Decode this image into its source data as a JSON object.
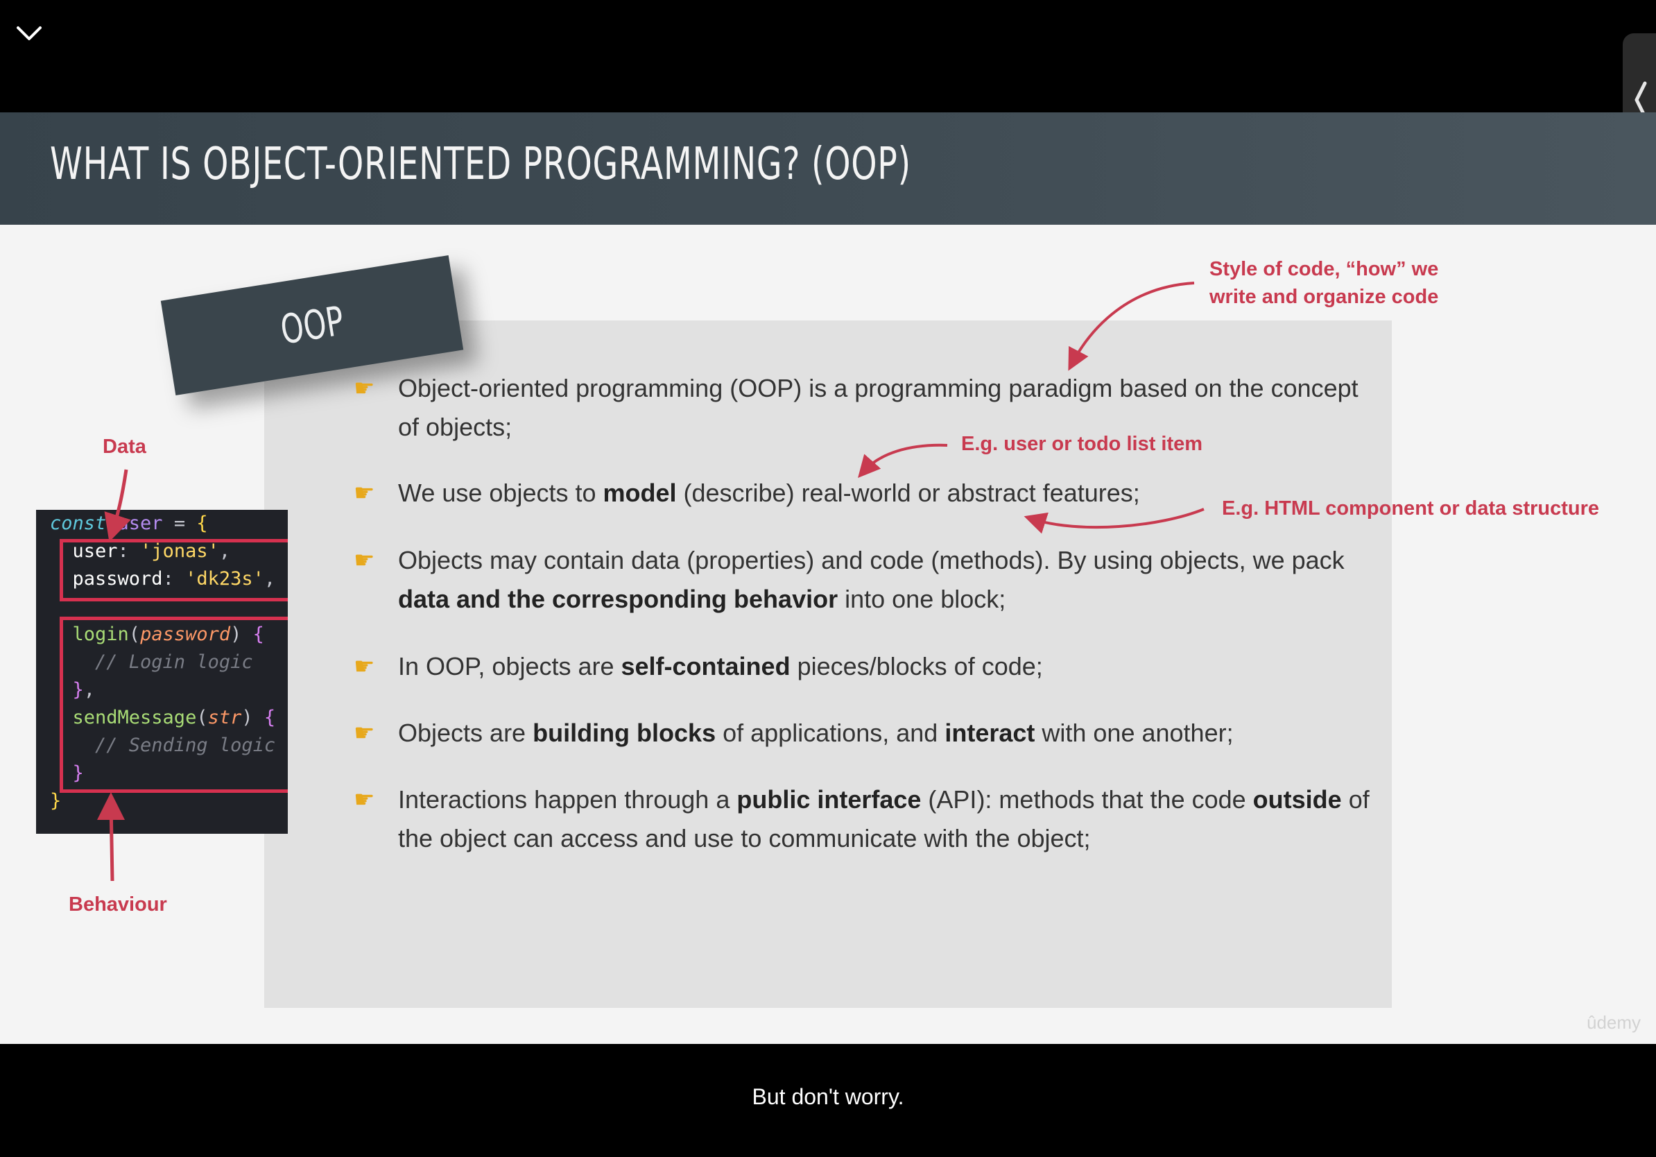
{
  "player": {
    "collapse_icon": "chevron-down-icon",
    "sidebar_toggle_icon": "chevron-left-icon",
    "caption": "But don't worry."
  },
  "slide": {
    "title": "WHAT IS OBJECT-ORIENTED PROGRAMMING? (OOP)",
    "tag": "OOP",
    "watermark": "ûdemy",
    "bullets": [
      {
        "parts": [
          {
            "t": "Object-oriented programming (OOP) is a programming paradigm based on the concept of objects;"
          }
        ]
      },
      {
        "parts": [
          {
            "t": "We use objects to "
          },
          {
            "t": "model",
            "b": true
          },
          {
            "t": " (describe) real-world or abstract features;"
          }
        ]
      },
      {
        "parts": [
          {
            "t": "Objects may contain data (properties) and code (methods). By using objects, we pack "
          },
          {
            "t": "data and the corresponding behavior",
            "b": true
          },
          {
            "t": " into one block;"
          }
        ]
      },
      {
        "parts": [
          {
            "t": "In OOP, objects are "
          },
          {
            "t": "self-contained",
            "b": true
          },
          {
            "t": " pieces/blocks of code;"
          }
        ]
      },
      {
        "parts": [
          {
            "t": "Objects are "
          },
          {
            "t": "building blocks",
            "b": true
          },
          {
            "t": " of applications, and "
          },
          {
            "t": "interact",
            "b": true
          },
          {
            "t": " with one another;"
          }
        ]
      },
      {
        "parts": [
          {
            "t": "Interactions happen through a "
          },
          {
            "t": "public interface",
            "b": true
          },
          {
            "t": " (API): methods that the code "
          },
          {
            "t": "outside",
            "b": true
          },
          {
            "t": " of the object can access and use to communicate with the object;"
          }
        ]
      }
    ],
    "annotations": {
      "style": "Style of code, “how” we write and organize code",
      "user": "E.g. user or todo list item",
      "html": "E.g. HTML component or data structure",
      "data": "Data",
      "behaviour": "Behaviour"
    },
    "code_lines": [
      [
        {
          "t": "const",
          "c": "#5fc9dc",
          "i": true
        },
        {
          "t": " user ",
          "c": "#b58cf0"
        },
        {
          "t": "=",
          "c": "#c6c8d0"
        },
        {
          "t": " {",
          "c": "#ffd84a"
        }
      ],
      [
        {
          "t": "  user",
          "c": "#ffffff"
        },
        {
          "t": ": ",
          "c": "#c6c8d0"
        },
        {
          "t": "'jonas'",
          "c": "#ffd866"
        },
        {
          "t": ",",
          "c": "#c6c8d0"
        }
      ],
      [
        {
          "t": "  password",
          "c": "#ffffff"
        },
        {
          "t": ": ",
          "c": "#c6c8d0"
        },
        {
          "t": "'dk23s'",
          "c": "#ffd866"
        },
        {
          "t": ",",
          "c": "#c6c8d0"
        }
      ],
      [],
      [
        {
          "t": "  login",
          "c": "#a9dc76"
        },
        {
          "t": "(",
          "c": "#c6c8d0"
        },
        {
          "t": "password",
          "c": "#fc9867",
          "i": true
        },
        {
          "t": ") ",
          "c": "#c6c8d0"
        },
        {
          "t": "{",
          "c": "#d67ff0"
        }
      ],
      [
        {
          "t": "    // Login logic",
          "c": "#7a7d86",
          "i": true
        }
      ],
      [
        {
          "t": "  }",
          "c": "#d67ff0"
        },
        {
          "t": ",",
          "c": "#c6c8d0"
        }
      ],
      [
        {
          "t": "  sendMessage",
          "c": "#a9dc76"
        },
        {
          "t": "(",
          "c": "#c6c8d0"
        },
        {
          "t": "str",
          "c": "#fc9867",
          "i": true
        },
        {
          "t": ") ",
          "c": "#c6c8d0"
        },
        {
          "t": "{",
          "c": "#d67ff0"
        }
      ],
      [
        {
          "t": "    // Sending logic",
          "c": "#7a7d86",
          "i": true
        }
      ],
      [
        {
          "t": "  }",
          "c": "#d67ff0"
        }
      ],
      [
        {
          "t": "}",
          "c": "#ffd84a"
        }
      ]
    ]
  }
}
